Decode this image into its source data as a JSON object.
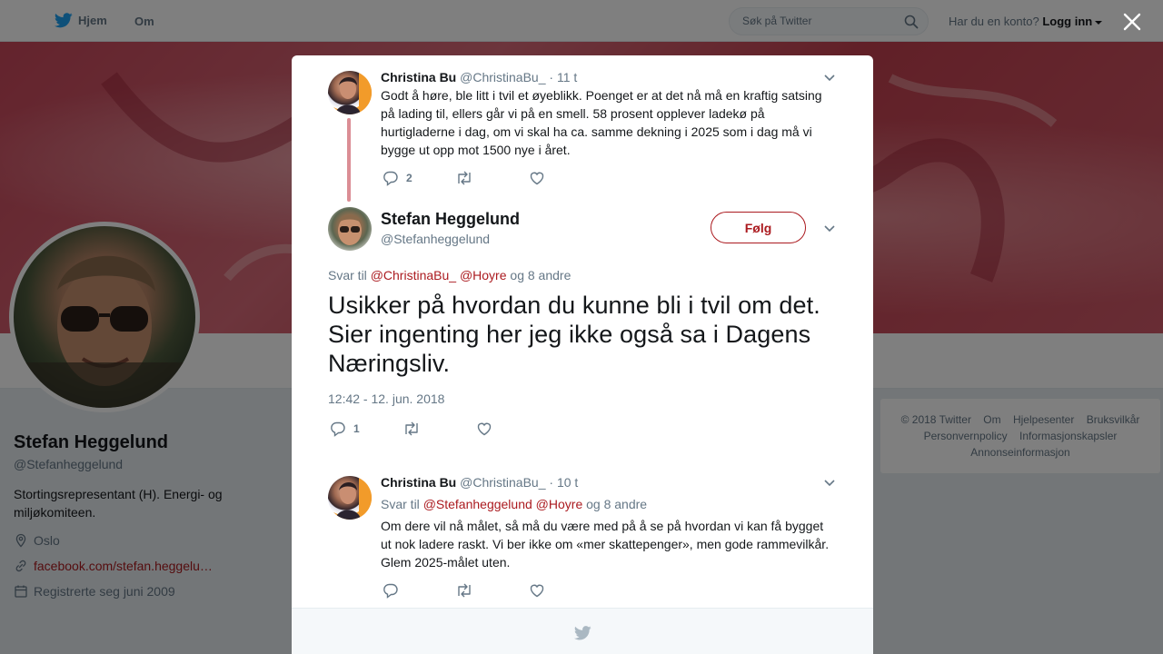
{
  "topbar": {
    "home_label": "Hjem",
    "about_label": "Om",
    "search_placeholder": "Søk på Twitter",
    "login_prompt": "Har du en konto?",
    "login_label": "Logg inn"
  },
  "profile": {
    "name": "Stefan Heggelund",
    "handle": "@Stefanheggelund",
    "bio": "Stortingsrepresentant (H). Energi- og miljøkomiteen.",
    "location": "Oslo",
    "website": "facebook.com/stefan.heggelu…",
    "joined": "Registrerte seg juni 2009"
  },
  "footer": {
    "links_row1": [
      "© 2018 Twitter",
      "Om",
      "Hjelpesenter",
      "Bruksvilkår"
    ],
    "links_row2": [
      "Personvernpolicy",
      "Informasjonskapsler"
    ],
    "links_row3": [
      "Annonseinformasjon"
    ]
  },
  "modal": {
    "parent_tweet": {
      "name": "Christina Bu",
      "handle": "@ChristinaBu_",
      "time": "· 11 t",
      "text": "Godt å høre, ble litt i tvil et øyeblikk. Poenget er at det nå må en kraftig satsing på lading til, ellers går vi på en smell. 58 prosent opplever ladekø på hurtigladerne i dag, om vi skal ha ca. samme dekning i 2025 som i dag må vi bygge ut opp mot 1500 nye i året.",
      "reply_count": "2"
    },
    "main_tweet": {
      "name": "Stefan Heggelund",
      "handle": "@Stefanheggelund",
      "follow_label": "Følg",
      "reply_prefix": "Svar til",
      "mention1": "@ChristinaBu_",
      "mention2": "@Hoyre",
      "reply_suffix": "og 8 andre",
      "text": "Usikker på hvordan du kunne bli i tvil om det. Sier ingenting her jeg ikke også sa i Dagens Næringsliv.",
      "datetime": "12:42 - 12. jun. 2018",
      "reply_count": "1"
    },
    "reply_tweet": {
      "name": "Christina Bu",
      "handle": "@ChristinaBu_",
      "time": "· 10 t",
      "reply_prefix": "Svar til",
      "mention1": "@Stefanheggelund",
      "mention2": "@Hoyre",
      "reply_suffix": "og 8 andre",
      "text": "Om dere vil nå målet, så må du være med på å se på hvordan vi kan få bygget ut nok ladere raskt. Vi ber ikke om «mer skattepenger», men gode rammevilkår. Glem 2025-målet uten."
    }
  },
  "colors": {
    "accent": "#ab1a1f",
    "twitter_blue": "#1da1f2",
    "muted": "#657786",
    "thread_line": "#db8e95"
  }
}
